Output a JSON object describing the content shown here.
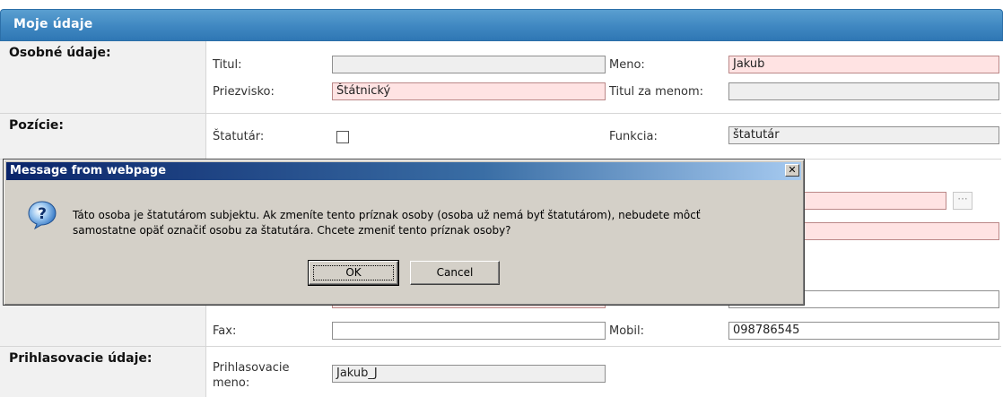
{
  "header": {
    "title": "Moje údaje"
  },
  "personal": {
    "section_label": "Osobné údaje:",
    "titul_label": "Titul:",
    "titul_value": "",
    "meno_label": "Meno:",
    "meno_value": "Jakub",
    "priezvisko_label": "Priezvisko:",
    "priezvisko_value": "Štátnický",
    "titul_za_label": "Titul za menom:",
    "titul_za_value": ""
  },
  "positions": {
    "section_label": "Pozície:",
    "statutar_label": "Štatutár:",
    "statutar_checked": false,
    "funkcia_label": "Funkcia:",
    "funkcia_value": "štatutár"
  },
  "contact": {
    "fax_label": "Fax:",
    "fax_value": "",
    "mobil_label": "Mobil:",
    "mobil_value": "098786545"
  },
  "login": {
    "section_label": "Prihlasovacie údaje:",
    "username_label_line1": "Prihlasovacie",
    "username_label_line2": "meno:",
    "username_value": "Jakub_J"
  },
  "dialog": {
    "title": "Message from webpage",
    "close_glyph": "✕",
    "message_line1": "Táto osoba je štatutárom subjektu. Ak zmeníte tento príznak osoby (osoba už nemá byť štatutárom), nebudete môcť",
    "message_line2": "samostatne opäť označiť osobu za štatutára. Chcete zmeniť tento príznak osoby?",
    "ok_label": "OK",
    "cancel_label": "Cancel",
    "icon": "question-icon"
  },
  "lookup_button": {
    "label": "···"
  }
}
